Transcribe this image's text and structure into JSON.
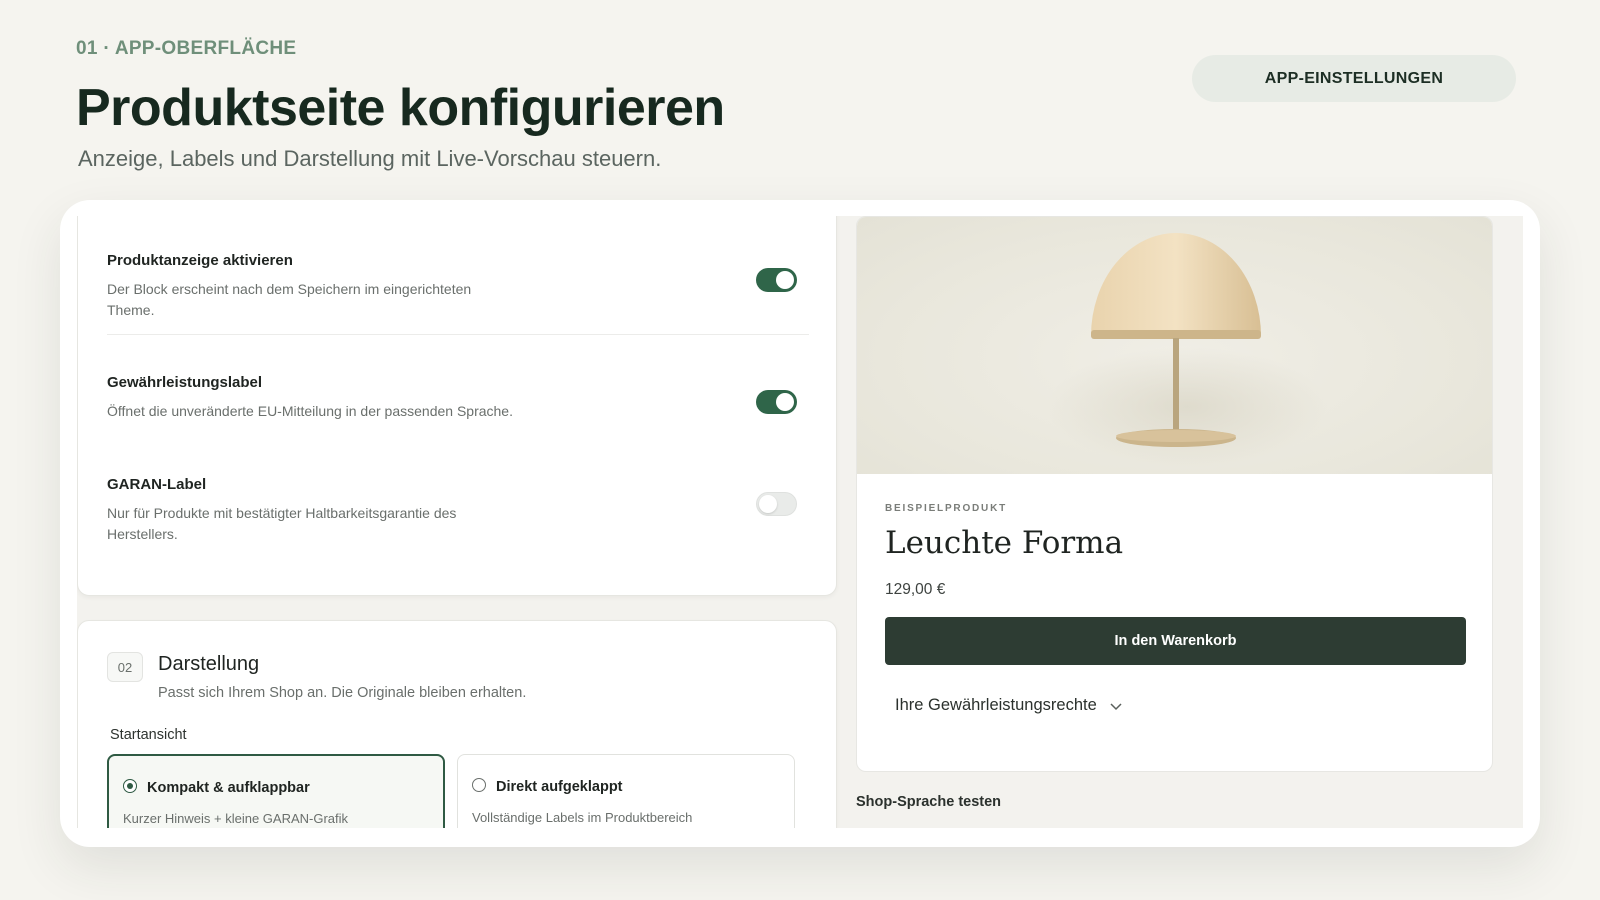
{
  "header": {
    "eyebrow": "01 · APP-OBERFLÄCHE",
    "title": "Produktseite konfigurieren",
    "subtitle": "Anzeige, Labels und Darstellung mit Live-Vorschau steuern.",
    "settings_button": "APP-EINSTELLUNGEN"
  },
  "settings": {
    "items": [
      {
        "title": "Produktanzeige aktivieren",
        "description": "Der Block erscheint nach dem Speichern im eingerichteten Theme.",
        "enabled": true
      },
      {
        "title": "Gewährleistungslabel",
        "description": "Öffnet die unveränderte EU-Mitteilung in der passenden Sprache.",
        "enabled": true
      },
      {
        "title": "GARAN-Label",
        "description": "Nur für Produkte mit bestätigter Haltbarkeitsgarantie des Herstellers.",
        "enabled": false
      }
    ]
  },
  "display_section": {
    "number": "02",
    "title": "Darstellung",
    "description": "Passt sich Ihrem Shop an. Die Originale bleiben erhalten.",
    "start_view_label": "Startansicht",
    "options": [
      {
        "title": "Kompakt & aufklappbar",
        "description": "Kurzer Hinweis + kleine GARAN-Grafik",
        "selected": true
      },
      {
        "title": "Direkt aufgeklappt",
        "description": "Vollständige Labels im Produktbereich",
        "selected": false
      }
    ]
  },
  "preview": {
    "eyebrow": "BEISPIELPRODUKT",
    "product_name": "Leuchte Forma",
    "price": "129,00 €",
    "cart_button": "In den Warenkorb",
    "warranty_link": "Ihre Gewährleistungsrechte",
    "language_label": "Shop-Sprache testen"
  },
  "colors": {
    "accent": "#2f6549",
    "dark_button": "#2d3c33",
    "background": "#f5f4ef"
  }
}
